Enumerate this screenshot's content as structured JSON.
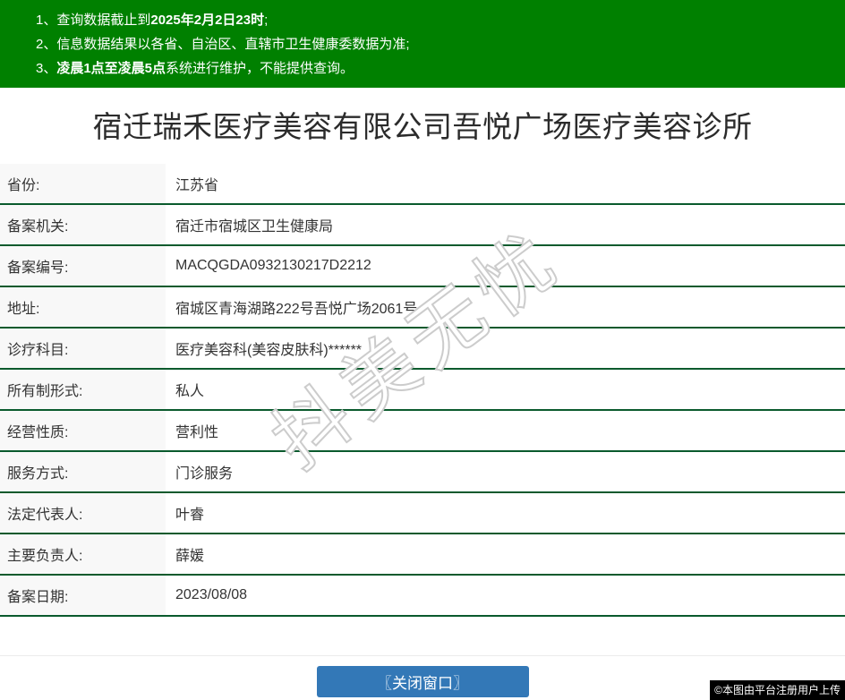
{
  "colors": {
    "banner_green": "#008000",
    "row_border_green": "#0a5a2d",
    "label_bg": "#f8f8f8",
    "button_blue": "#3378b7",
    "text_dark": "#333333",
    "badge_bg": "#000000",
    "badge_text": "#ffffff"
  },
  "banner": {
    "items": [
      {
        "num": "1、",
        "pre": "查询数据截止到",
        "bold": "2025年2月2日23时",
        "post": ";"
      },
      {
        "num": "2、",
        "pre": "信息数据结果以各省、自治区、直辖市卫生健康委数据为准;",
        "bold": "",
        "post": ""
      },
      {
        "num": "3、",
        "pre": "",
        "bold": "凌晨1点至凌晨5点",
        "post": "系统进行维护，不能提供查询。"
      }
    ]
  },
  "title": "宿迁瑞禾医疗美容有限公司吾悦广场医疗美容诊所",
  "table": {
    "rows": [
      {
        "label": "省份:",
        "value": "江苏省"
      },
      {
        "label": "备案机关:",
        "value": "宿迁市宿城区卫生健康局"
      },
      {
        "label": "备案编号:",
        "value": "MACQGDA0932130217D2212"
      },
      {
        "label": "地址:",
        "value": "宿城区青海湖路222号吾悦广场2061号"
      },
      {
        "label": "诊疗科目:",
        "value": "医疗美容科(美容皮肤科)******"
      },
      {
        "label": "所有制形式:",
        "value": "私人"
      },
      {
        "label": "经营性质:",
        "value": "营利性"
      },
      {
        "label": "服务方式:",
        "value": "门诊服务"
      },
      {
        "label": "法定代表人:",
        "value": "叶睿"
      },
      {
        "label": "主要负责人:",
        "value": "薛媛"
      },
      {
        "label": "备案日期:",
        "value": "2023/08/08"
      }
    ]
  },
  "watermark": {
    "text": "抖美无忧"
  },
  "footer": {
    "close_button_label": "〖关闭窗口〗",
    "upload_credit": "©本图由平台注册用户上传"
  }
}
